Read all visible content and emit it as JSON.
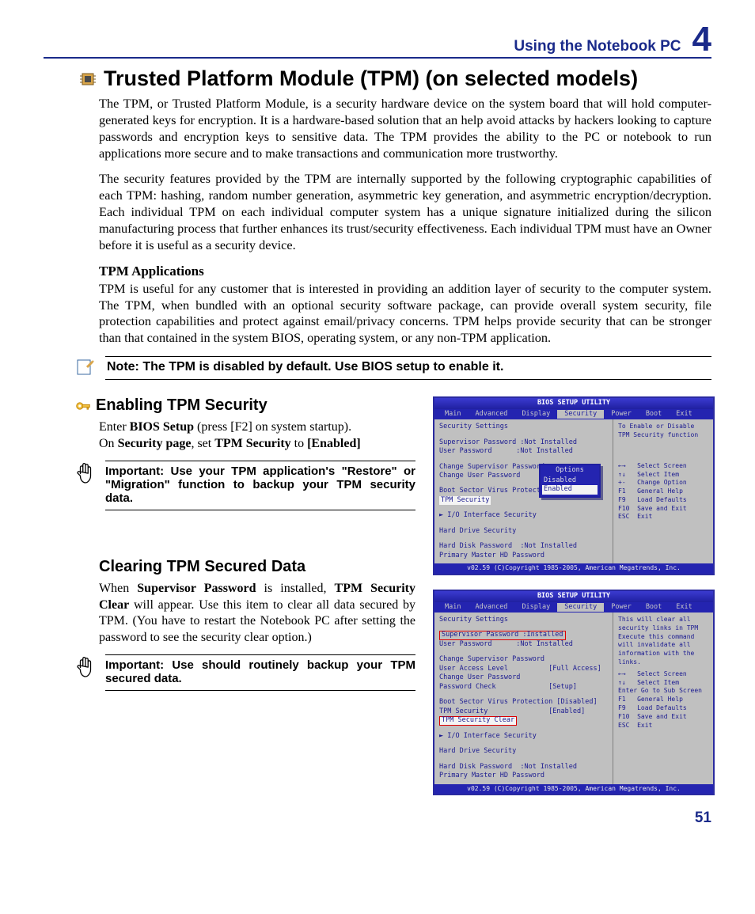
{
  "header": {
    "section": "Using the Notebook PC",
    "chapter": "4"
  },
  "title": "Trusted Platform Module (TPM) (on selected models)",
  "paragraphs": {
    "intro1": "The TPM, or Trusted Platform Module, is a security hardware device on the system board that will hold computer-generated keys for encryption. It is a hardware-based solution that an help avoid attacks by hackers looking to capture passwords and encryption keys to sensitive data. The TPM provides the ability to the PC or notebook to run applications more secure and to make transactions and communication more trustworthy.",
    "intro2": "The security features provided by the TPM are internally supported by the following cryptographic capabilities of each TPM: hashing, random number generation, asymmetric key generation, and asymmetric encryption/decryption. Each individual TPM on each individual computer system has a unique signature initialized during the silicon manufacturing process that further enhances its trust/security effectiveness. Each individual TPM must have an Owner before it is useful as a security device.",
    "apps_heading": "TPM Applications",
    "apps_body": "TPM is useful for any customer that is interested in providing an addition layer of security to the computer system. The TPM, when bundled with an optional security software package, can provide overall system security, file protection capabilities and protect against email/privacy concerns. TPM helps provide security that can be stronger than that contained in the system BIOS, operating system, or any non-TPM application."
  },
  "note": "Note: The TPM is disabled by default. Use BIOS setup to enable it.",
  "sections": {
    "enable": {
      "title": "Enabling TPM Security",
      "line1a": "Enter ",
      "line1b": "BIOS Setup",
      "line1c": " (press [F2] on system startup).",
      "line2a": "On ",
      "line2b": "Security page",
      "line2c": ", set ",
      "line2d": "TPM Security",
      "line2e": " to ",
      "line2f": "[Enabled]",
      "important": "Important: Use your TPM application's \"Restore\" or \"Migration\" function to backup your TPM security data."
    },
    "clear": {
      "title": "Clearing TPM Secured Data",
      "body_pre": "When ",
      "body_b1": "Supervisor Password",
      "body_mid1": " is installed, ",
      "body_b2": "TPM Security Clear",
      "body_post": " will appear. Use this item to clear all data secured by TPM. (You have to restart the Notebook PC after setting the password to see the security clear option.)",
      "important": "Important: Use should routinely backup your TPM secured data."
    }
  },
  "bios_common": {
    "title": "BIOS SETUP UTILITY",
    "tabs": [
      "Main",
      "Advanced",
      "Display",
      "Security",
      "Power",
      "Boot",
      "Exit"
    ],
    "selected_tab": "Security",
    "footer": "v02.59 (C)Copyright 1985-2005, American Megatrends, Inc."
  },
  "bios1": {
    "help": "To Enable or Disable\nTPM Security function",
    "keys": "←→   Select Screen\n↑↓   Select Item\n+-   Change Option\nF1   General Help\nF9   Load Defaults\nF10  Save and Exit\nESC  Exit",
    "left": {
      "heading": "Security Settings",
      "sup": "Supervisor Password :Not Installed",
      "usr": "User Password      :Not Installed",
      "csp": "Change Supervisor Password",
      "cup": "Change User Password",
      "bsvp": "Boot Sector Virus Protectio",
      "tpm": "TPM Security",
      "io": "► I/O Interface Security",
      "hds": "Hard Drive Security",
      "hdp": "Hard Disk Password  :Not Installed",
      "pmh": "Primary Master HD Password"
    },
    "popup": {
      "title": "Options",
      "items": [
        "Disabled",
        "Enabled"
      ],
      "selected": "Enabled"
    }
  },
  "bios2": {
    "help": "This will clear all\nsecurity links in TPM\nExecute this command\nwill invalidate all\ninformation with the\nlinks.",
    "keys": "←→   Select Screen\n↑↓   Select Item\nEnter Go to Sub Screen\nF1   General Help\nF9   Load Defaults\nF10  Save and Exit\nESC  Exit",
    "left": {
      "heading": "Security Settings",
      "sup_label": "Supervisor Password :Installed",
      "usr": "User Password      :Not Installed",
      "csp": "Change Supervisor Password",
      "ual": "User Access Level          [Full Access]",
      "cup": "Change User Password",
      "pwc": "Password Check             [Setup]",
      "bsvp": "Boot Sector Virus Protection [Disabled]",
      "tpm": "TPM Security               [Enabled]",
      "tsc": "TPM Security Clear",
      "io": "► I/O Interface Security",
      "hds": "Hard Drive Security",
      "hdp": "Hard Disk Password  :Not Installed",
      "pmh": "Primary Master HD Password"
    }
  },
  "page_number": "51"
}
